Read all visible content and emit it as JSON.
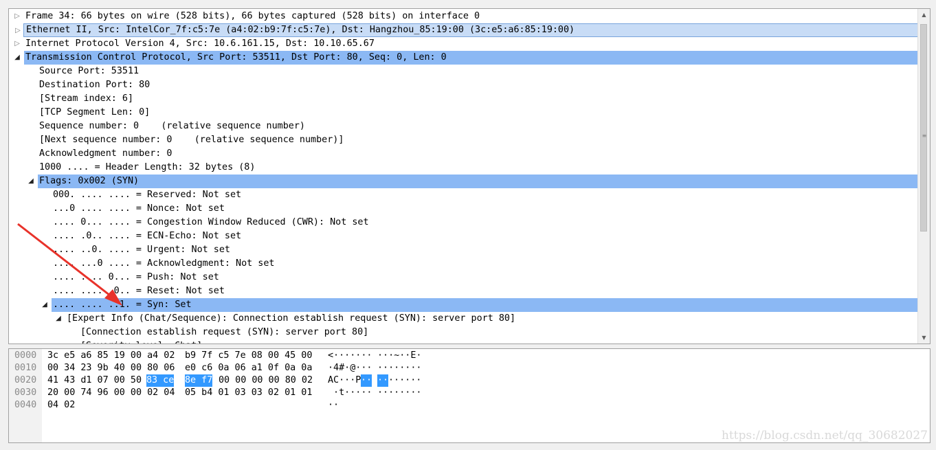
{
  "tree": {
    "rows": [
      {
        "text": "Frame 34: 66 bytes on wire (528 bits), 66 bytes captured (528 bits) on interface 0",
        "toggle": "collapsed"
      },
      {
        "text": "Ethernet II, Src: IntelCor_7f:c5:7e (a4:02:b9:7f:c5:7e), Dst: Hangzhou_85:19:00 (3c:e5:a6:85:19:00)",
        "toggle": "collapsed"
      },
      {
        "text": "Internet Protocol Version 4, Src: 10.6.161.15, Dst: 10.10.65.67",
        "toggle": "collapsed"
      },
      {
        "text": "Transmission Control Protocol, Src Port: 53511, Dst Port: 80, Seq: 0, Len: 0",
        "toggle": "expanded"
      },
      {
        "text": "Source Port: 53511"
      },
      {
        "text": "Destination Port: 80"
      },
      {
        "text": "[Stream index: 6]"
      },
      {
        "text": "[TCP Segment Len: 0]"
      },
      {
        "text": "Sequence number: 0    (relative sequence number)"
      },
      {
        "text": "[Next sequence number: 0    (relative sequence number)]"
      },
      {
        "text": "Acknowledgment number: 0"
      },
      {
        "text": "1000 .... = Header Length: 32 bytes (8)"
      },
      {
        "text": "Flags: 0x002 (SYN)",
        "toggle": "expanded"
      },
      {
        "text": "000. .... .... = Reserved: Not set"
      },
      {
        "text": "...0 .... .... = Nonce: Not set"
      },
      {
        "text": ".... 0... .... = Congestion Window Reduced (CWR): Not set"
      },
      {
        "text": ".... .0.. .... = ECN-Echo: Not set"
      },
      {
        "text": ".... ..0. .... = Urgent: Not set"
      },
      {
        "text": ".... ...0 .... = Acknowledgment: Not set"
      },
      {
        "text": ".... .... 0... = Push: Not set"
      },
      {
        "text": ".... .... .0.. = Reset: Not set"
      },
      {
        "text": ".... .... ..1. = Syn: Set",
        "toggle": "expanded"
      },
      {
        "text": "[Expert Info (Chat/Sequence): Connection establish request (SYN): server port 80]",
        "toggle": "expanded"
      },
      {
        "text": "[Connection establish request (SYN): server port 80]"
      },
      {
        "text": "[Severity level: Chat]"
      }
    ]
  },
  "hex": {
    "lines": [
      {
        "offset": "0000",
        "a": "3c e5 a6 85 19 00 a4 02",
        "b": "b9 7f c5 7e 08 00 45 00",
        "ascii1": "<·······",
        "ascii2": "···~··E·"
      },
      {
        "offset": "0010",
        "a": "00 34 23 9b 40 00 80 06",
        "b": "e0 c6 0a 06 a1 0f 0a 0a",
        "ascii1": "·4#·@···",
        "ascii2": "········"
      },
      {
        "offset": "0020",
        "a1": "41 43 d1 07 00 50",
        "asel": "83 ce",
        "bsel": "8e f7",
        "b2": "00 00 00 00 80 02",
        "ascii1a": "AC···P",
        "ascii1b": "··",
        "ascii2a": "··",
        "ascii2b": "······"
      },
      {
        "offset": "0030",
        "a": "20 00 74 96 00 00 02 04",
        "b": "05 b4 01 03 03 02 01 01",
        "ascii1": " ·t·····",
        "ascii2": "········"
      },
      {
        "offset": "0040",
        "a": "04 02",
        "b": "",
        "ascii1": "··",
        "ascii2": ""
      }
    ]
  },
  "watermark": "https://blog.csdn.net/qq_30682027",
  "colors": {
    "row_highlight": "#8bb8f4",
    "byte_selection": "#3399ff",
    "annotation_arrow": "#e8322a"
  }
}
